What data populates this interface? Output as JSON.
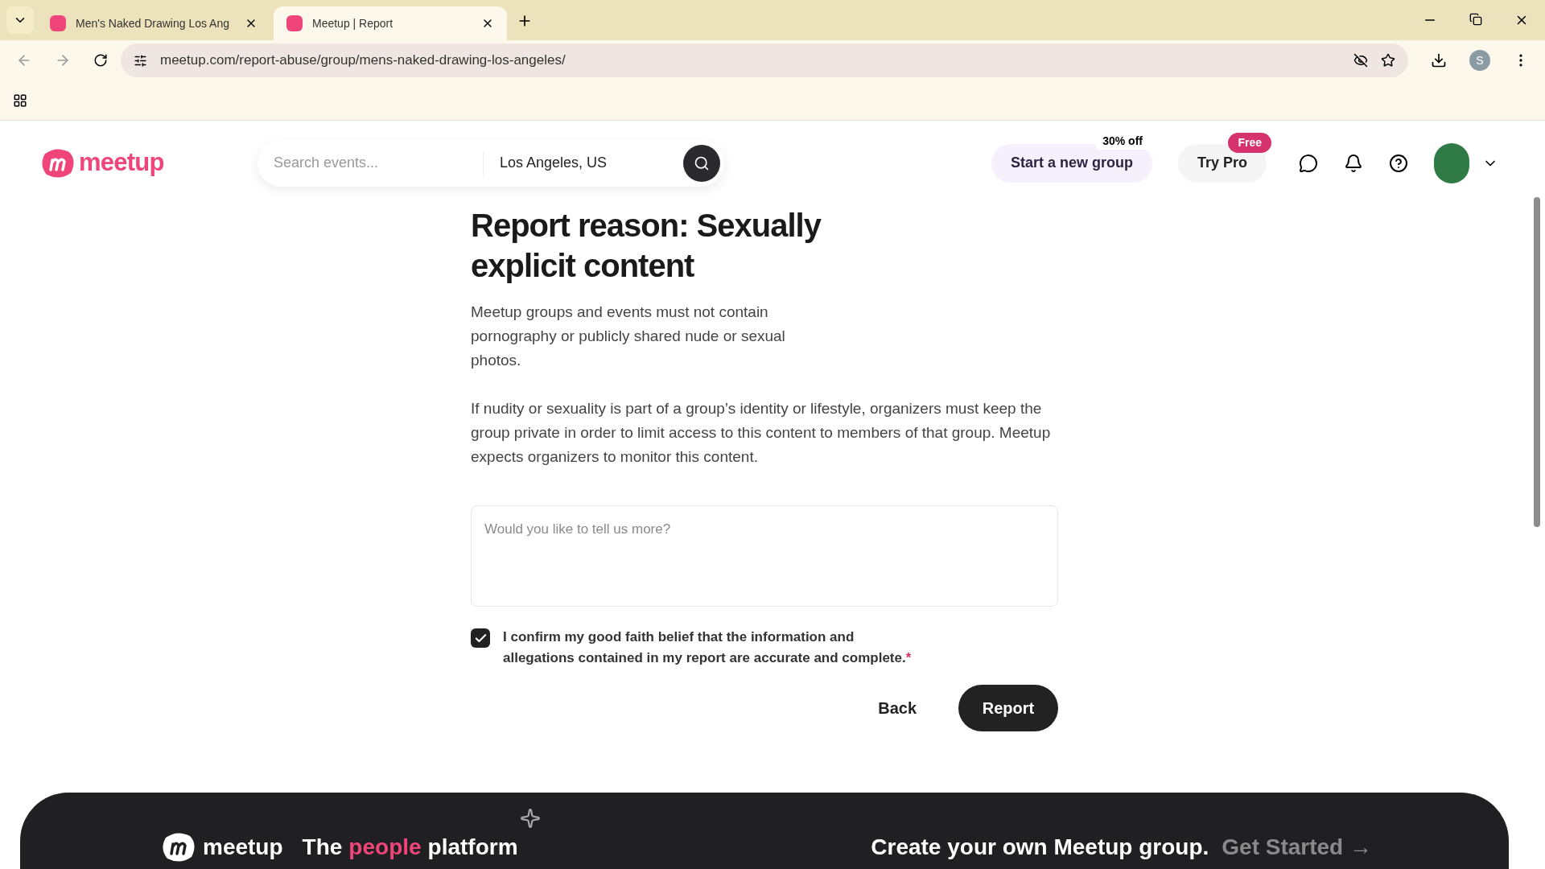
{
  "browser": {
    "tabs": [
      {
        "title": "Men's Naked Drawing Los Ang",
        "selected": false
      },
      {
        "title": "Meetup | Report",
        "selected": true
      }
    ],
    "address": "meetup.com/report-abuse/group/mens-naked-drawing-los-angeles/",
    "profile_initial": "S"
  },
  "header": {
    "logo": "meetup",
    "search_placeholder": "Search events...",
    "location": "Los Angeles, US",
    "start_group": {
      "label": "Start a new group",
      "badge": "30% off"
    },
    "try_pro": {
      "label": "Try Pro",
      "badge": "Free"
    }
  },
  "report": {
    "title": "Report reason: Sexually explicit content",
    "paragraphs": [
      "Meetup groups and events must not contain pornography or publicly shared nude or sexual photos.",
      "If nudity or sexuality is part of a group’s identity or lifestyle, organizers must keep the group private in order to limit access to this content to members of that group. Meetup expects organizers to monitor this content."
    ],
    "details_placeholder": "Would you like to tell us more?",
    "confirm": {
      "label": "I confirm my good faith belief that the information and allegations contained in my report are accurate and complete.",
      "required_mark": "*",
      "checked": true
    },
    "buttons": [
      {
        "label": "Back",
        "kind": "text"
      },
      {
        "label": "Report",
        "kind": "primary"
      }
    ]
  },
  "footer": {
    "logo": "meetup",
    "tagline": [
      {
        "text": "The",
        "highlighted": false
      },
      {
        "text": "people",
        "highlighted": true
      },
      {
        "text": "platform",
        "highlighted": false
      }
    ],
    "cta": "Create your own Meetup group.",
    "cta_link": "Get Started →"
  }
}
